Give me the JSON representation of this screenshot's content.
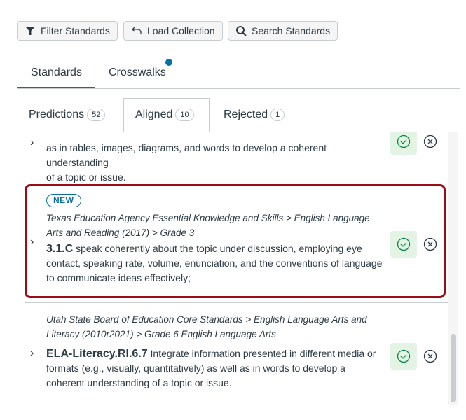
{
  "toolbar": {
    "filter": "Filter Standards",
    "load": "Load Collection",
    "search": "Search Standards"
  },
  "tabs": [
    {
      "label": "Standards",
      "active": true
    },
    {
      "label": "Crosswalks",
      "has_notification": true
    }
  ],
  "subtabs": [
    {
      "label": "Predictions",
      "count": "52"
    },
    {
      "label": "Aligned",
      "count": "10",
      "active": true
    },
    {
      "label": "Rejected",
      "count": "1"
    }
  ],
  "items": [
    {
      "lines": [
        "as in tables, images, diagrams, and words to develop a coherent understanding",
        "of a topic or issue."
      ]
    },
    {
      "badge": "NEW",
      "source": "Texas Education Agency Essential Knowledge and Skills > English Language Arts and Reading (2017) > Grade 3",
      "code": "3.1.C",
      "description": "speak coherently about the topic under discussion, employing eye contact, speaking rate, volume, enunciation, and the conventions of language to communicate ideas effectively;",
      "highlighted": true
    },
    {
      "source": "Utah State Board of Education Core Standards > English Language Arts and Literacy (2010r2021) > Grade 6 English Language Arts",
      "code": "ELA-Literacy.RI.6.7",
      "description": "Integrate information presented in different media or formats (e.g., visually, quantitatively) as well as in words to develop a coherent understanding of a topic or issue."
    }
  ],
  "colors": {
    "accent": "#0770a3",
    "highlight": "#9b0d16",
    "success": "#0b874b"
  }
}
